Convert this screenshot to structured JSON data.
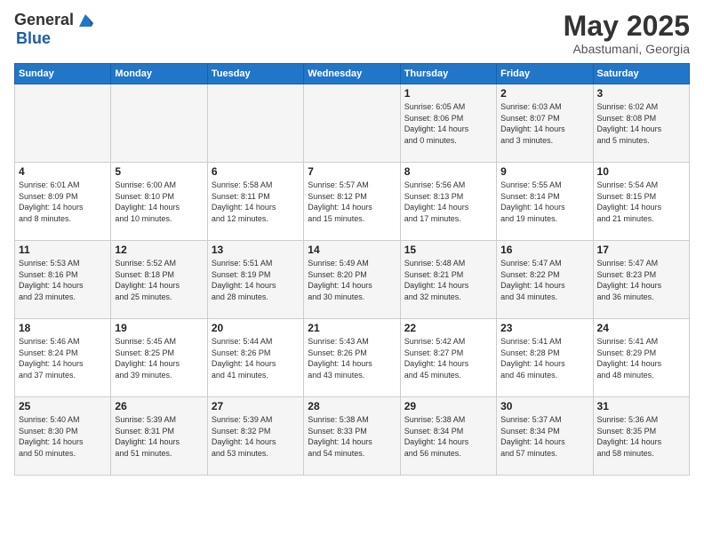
{
  "header": {
    "logo_general": "General",
    "logo_blue": "Blue",
    "title": "May 2025",
    "location": "Abastumani, Georgia"
  },
  "days_of_week": [
    "Sunday",
    "Monday",
    "Tuesday",
    "Wednesday",
    "Thursday",
    "Friday",
    "Saturday"
  ],
  "weeks": [
    [
      {
        "day": "",
        "info": ""
      },
      {
        "day": "",
        "info": ""
      },
      {
        "day": "",
        "info": ""
      },
      {
        "day": "",
        "info": ""
      },
      {
        "day": "1",
        "info": "Sunrise: 6:05 AM\nSunset: 8:06 PM\nDaylight: 14 hours\nand 0 minutes."
      },
      {
        "day": "2",
        "info": "Sunrise: 6:03 AM\nSunset: 8:07 PM\nDaylight: 14 hours\nand 3 minutes."
      },
      {
        "day": "3",
        "info": "Sunrise: 6:02 AM\nSunset: 8:08 PM\nDaylight: 14 hours\nand 5 minutes."
      }
    ],
    [
      {
        "day": "4",
        "info": "Sunrise: 6:01 AM\nSunset: 8:09 PM\nDaylight: 14 hours\nand 8 minutes."
      },
      {
        "day": "5",
        "info": "Sunrise: 6:00 AM\nSunset: 8:10 PM\nDaylight: 14 hours\nand 10 minutes."
      },
      {
        "day": "6",
        "info": "Sunrise: 5:58 AM\nSunset: 8:11 PM\nDaylight: 14 hours\nand 12 minutes."
      },
      {
        "day": "7",
        "info": "Sunrise: 5:57 AM\nSunset: 8:12 PM\nDaylight: 14 hours\nand 15 minutes."
      },
      {
        "day": "8",
        "info": "Sunrise: 5:56 AM\nSunset: 8:13 PM\nDaylight: 14 hours\nand 17 minutes."
      },
      {
        "day": "9",
        "info": "Sunrise: 5:55 AM\nSunset: 8:14 PM\nDaylight: 14 hours\nand 19 minutes."
      },
      {
        "day": "10",
        "info": "Sunrise: 5:54 AM\nSunset: 8:15 PM\nDaylight: 14 hours\nand 21 minutes."
      }
    ],
    [
      {
        "day": "11",
        "info": "Sunrise: 5:53 AM\nSunset: 8:16 PM\nDaylight: 14 hours\nand 23 minutes."
      },
      {
        "day": "12",
        "info": "Sunrise: 5:52 AM\nSunset: 8:18 PM\nDaylight: 14 hours\nand 25 minutes."
      },
      {
        "day": "13",
        "info": "Sunrise: 5:51 AM\nSunset: 8:19 PM\nDaylight: 14 hours\nand 28 minutes."
      },
      {
        "day": "14",
        "info": "Sunrise: 5:49 AM\nSunset: 8:20 PM\nDaylight: 14 hours\nand 30 minutes."
      },
      {
        "day": "15",
        "info": "Sunrise: 5:48 AM\nSunset: 8:21 PM\nDaylight: 14 hours\nand 32 minutes."
      },
      {
        "day": "16",
        "info": "Sunrise: 5:47 AM\nSunset: 8:22 PM\nDaylight: 14 hours\nand 34 minutes."
      },
      {
        "day": "17",
        "info": "Sunrise: 5:47 AM\nSunset: 8:23 PM\nDaylight: 14 hours\nand 36 minutes."
      }
    ],
    [
      {
        "day": "18",
        "info": "Sunrise: 5:46 AM\nSunset: 8:24 PM\nDaylight: 14 hours\nand 37 minutes."
      },
      {
        "day": "19",
        "info": "Sunrise: 5:45 AM\nSunset: 8:25 PM\nDaylight: 14 hours\nand 39 minutes."
      },
      {
        "day": "20",
        "info": "Sunrise: 5:44 AM\nSunset: 8:26 PM\nDaylight: 14 hours\nand 41 minutes."
      },
      {
        "day": "21",
        "info": "Sunrise: 5:43 AM\nSunset: 8:26 PM\nDaylight: 14 hours\nand 43 minutes."
      },
      {
        "day": "22",
        "info": "Sunrise: 5:42 AM\nSunset: 8:27 PM\nDaylight: 14 hours\nand 45 minutes."
      },
      {
        "day": "23",
        "info": "Sunrise: 5:41 AM\nSunset: 8:28 PM\nDaylight: 14 hours\nand 46 minutes."
      },
      {
        "day": "24",
        "info": "Sunrise: 5:41 AM\nSunset: 8:29 PM\nDaylight: 14 hours\nand 48 minutes."
      }
    ],
    [
      {
        "day": "25",
        "info": "Sunrise: 5:40 AM\nSunset: 8:30 PM\nDaylight: 14 hours\nand 50 minutes."
      },
      {
        "day": "26",
        "info": "Sunrise: 5:39 AM\nSunset: 8:31 PM\nDaylight: 14 hours\nand 51 minutes."
      },
      {
        "day": "27",
        "info": "Sunrise: 5:39 AM\nSunset: 8:32 PM\nDaylight: 14 hours\nand 53 minutes."
      },
      {
        "day": "28",
        "info": "Sunrise: 5:38 AM\nSunset: 8:33 PM\nDaylight: 14 hours\nand 54 minutes."
      },
      {
        "day": "29",
        "info": "Sunrise: 5:38 AM\nSunset: 8:34 PM\nDaylight: 14 hours\nand 56 minutes."
      },
      {
        "day": "30",
        "info": "Sunrise: 5:37 AM\nSunset: 8:34 PM\nDaylight: 14 hours\nand 57 minutes."
      },
      {
        "day": "31",
        "info": "Sunrise: 5:36 AM\nSunset: 8:35 PM\nDaylight: 14 hours\nand 58 minutes."
      }
    ]
  ]
}
